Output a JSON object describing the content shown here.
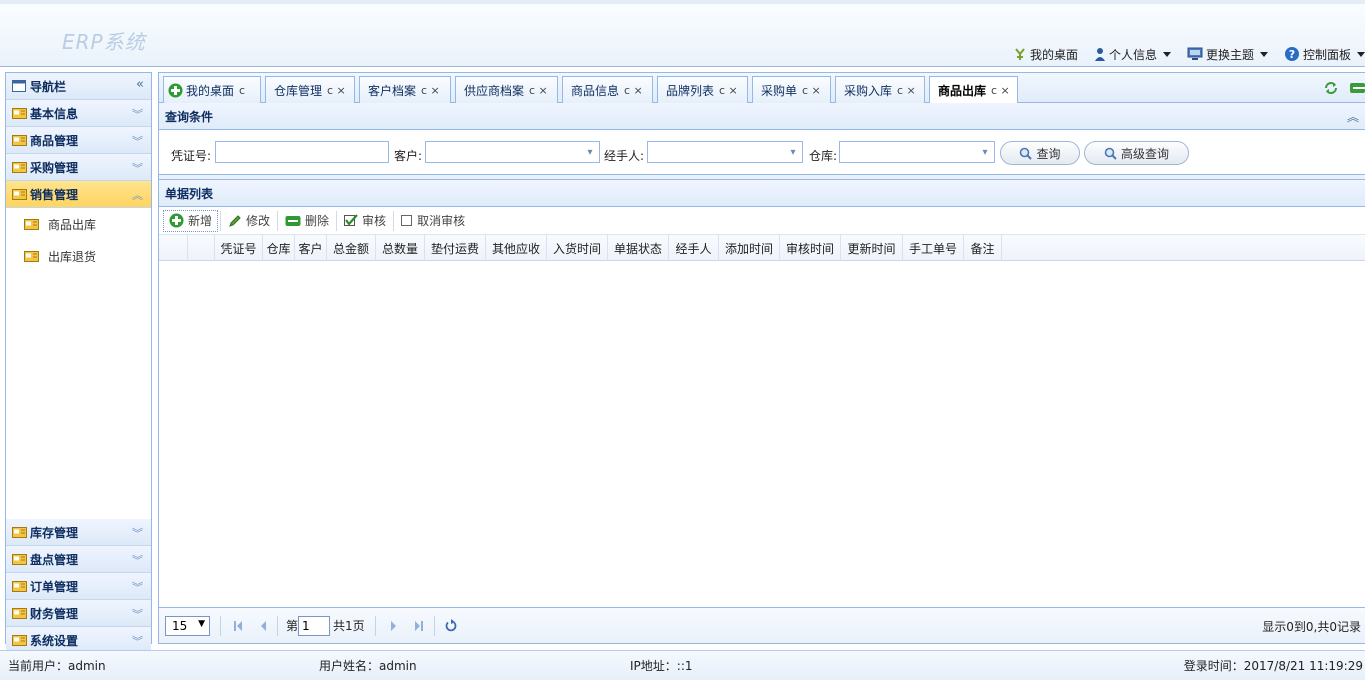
{
  "header": {
    "logo": "ERP系统",
    "links": [
      {
        "label": "我的桌面",
        "icon": "desktop-icon",
        "dropdown": false
      },
      {
        "label": "个人信息",
        "icon": "user-icon",
        "dropdown": true
      },
      {
        "label": "更换主题",
        "icon": "theme-icon",
        "dropdown": true
      },
      {
        "label": "控制面板",
        "icon": "help-icon",
        "dropdown": true
      }
    ]
  },
  "sidebar": {
    "title": "导航栏",
    "collapse_glyph": "«",
    "groups_top": [
      "基本信息",
      "商品管理",
      "采购管理"
    ],
    "active_group": "销售管理",
    "active_items": [
      "商品出库",
      "出库退货"
    ],
    "groups_bottom": [
      "库存管理",
      "盘点管理",
      "订单管理",
      "财务管理",
      "系统设置"
    ]
  },
  "tabs": [
    {
      "label": "我的桌面",
      "close": "c",
      "active": false,
      "icon": true
    },
    {
      "label": "仓库管理",
      "close": "c ×",
      "active": false
    },
    {
      "label": "客户档案",
      "close": "c ×",
      "active": false
    },
    {
      "label": "供应商档案",
      "close": "c ×",
      "active": false
    },
    {
      "label": "商品信息",
      "close": "c ×",
      "active": false
    },
    {
      "label": "品牌列表",
      "close": "c ×",
      "active": false
    },
    {
      "label": "采购单",
      "close": "c ×",
      "active": false
    },
    {
      "label": "采购入库",
      "close": "c ×",
      "active": false
    },
    {
      "label": "商品出库",
      "close": "c ×",
      "active": true
    }
  ],
  "query": {
    "title": "查询条件",
    "voucher_label": "凭证号:",
    "voucher_value": "",
    "customer_label": "客户:",
    "customer_value": "",
    "handler_label": "经手人:",
    "handler_value": "",
    "warehouse_label": "仓库:",
    "warehouse_value": "",
    "search_label": "查询",
    "advanced_label": "高级查询"
  },
  "list": {
    "title": "单据列表",
    "toolbar": {
      "add": "新增",
      "edit": "修改",
      "delete": "删除",
      "audit": "审核",
      "cancel_audit": "取消审核"
    },
    "columns": [
      "凭证号",
      "仓库",
      "客户",
      "总金额",
      "总数量",
      "垫付运费",
      "其他应收",
      "入货时间",
      "单据状态",
      "经手人",
      "添加时间",
      "审核时间",
      "更新时间",
      "手工单号",
      "备注"
    ],
    "rows": []
  },
  "pager": {
    "page_size": "15",
    "page_prefix": "第",
    "page": "1",
    "page_suffix": "共1页",
    "info": "显示0到0,共0记录"
  },
  "footer": {
    "user": "当前用户：admin",
    "name": "用户姓名：admin",
    "ip": "IP地址：::1",
    "login": "登录时间：2017/8/21 11:19:29"
  }
}
